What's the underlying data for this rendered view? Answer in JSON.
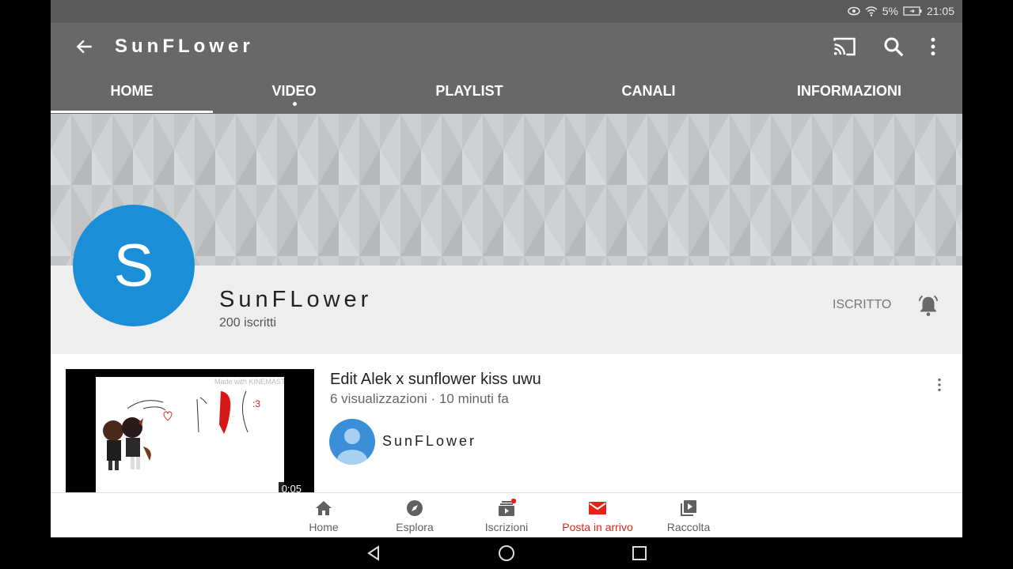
{
  "status_bar": {
    "battery": "5%",
    "time": "21:05"
  },
  "app_bar": {
    "title": "SunFLower"
  },
  "tabs": [
    {
      "label": "HOME",
      "active": true
    },
    {
      "label": "VIDEO",
      "has_dot": true
    },
    {
      "label": "PLAYLIST"
    },
    {
      "label": "CANALI"
    },
    {
      "label": "INFORMAZIONI"
    }
  ],
  "channel": {
    "avatar_letter": "S",
    "name": "SunFLower",
    "subscribers": "200 iscritti",
    "subscribe_label": "ISCRITTO",
    "avatar_color": "#1a8fd8"
  },
  "video": {
    "title": "Edit Alek x sunflower kiss uwu",
    "meta": "6 visualizzazioni · 10 minuti fa",
    "channel_name": "SunFLower",
    "duration": "0:05",
    "thumb_watermark": "Made with KINEMASTER",
    "thumb_drawn_text": ":3"
  },
  "bottom_nav": [
    {
      "label": "Home",
      "icon": "home-icon"
    },
    {
      "label": "Esplora",
      "icon": "compass-icon"
    },
    {
      "label": "Iscrizioni",
      "icon": "subscriptions-icon",
      "badge": true
    },
    {
      "label": "Posta in arrivo",
      "icon": "inbox-icon",
      "active": true
    },
    {
      "label": "Raccolta",
      "icon": "library-icon"
    }
  ],
  "colors": {
    "app_bar": "#686868",
    "accent_red": "#e62117",
    "avatar_blue": "#1a8fd8"
  }
}
